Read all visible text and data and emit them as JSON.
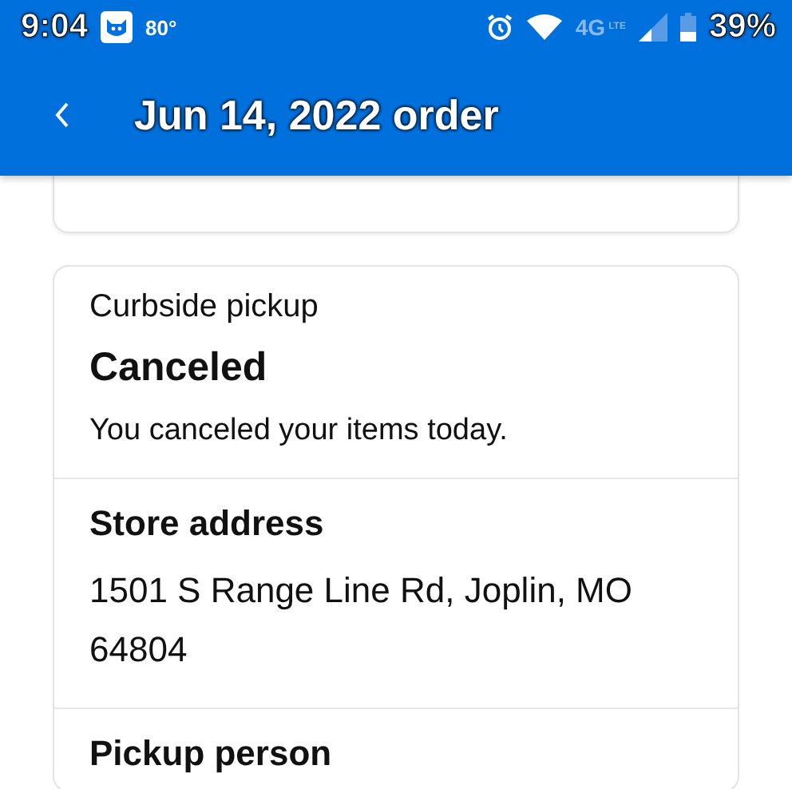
{
  "status_bar": {
    "time": "9:04",
    "temperature": "80°",
    "network": "4G",
    "network_sub": "LTE",
    "battery": "39%"
  },
  "header": {
    "title": "Jun 14, 2022 order"
  },
  "pickup_card": {
    "method": "Curbside pickup",
    "status": "Canceled",
    "message": "You canceled your items today.",
    "sections": [
      {
        "heading": "Store address",
        "lines": [
          "1501 S Range Line Rd, Joplin, MO",
          "64804"
        ]
      },
      {
        "heading": "Pickup person"
      }
    ]
  }
}
